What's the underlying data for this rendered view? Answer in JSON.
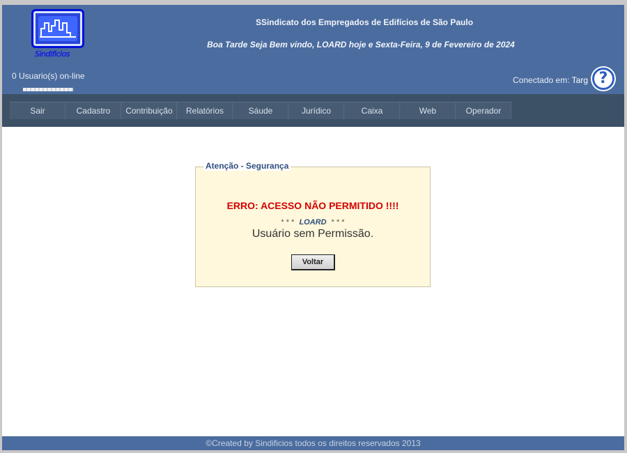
{
  "header": {
    "logo_text": "Sindificios",
    "users_online": "0 Usuario(s) on-line",
    "site_title": "SSindicato dos Empregados de Edifícios de São Paulo",
    "welcome": "Boa Tarde Seja Bem vindo, LOARD hoje e Sexta-Feira, 9 de Fevereiro de 2024",
    "connected_label": "Conectado em:",
    "connected_value": "Targ",
    "help_icon": "question-mark-icon",
    "help_symbol": "?"
  },
  "nav": {
    "items": [
      {
        "label": "Sair"
      },
      {
        "label": "Cadastro"
      },
      {
        "label": "Contribuição"
      },
      {
        "label": "Relatórios"
      },
      {
        "label": "Sáude"
      },
      {
        "label": "Jurídico"
      },
      {
        "label": "Caixa"
      },
      {
        "label": "Web"
      },
      {
        "label": "Operador"
      }
    ]
  },
  "alert": {
    "legend": "Atenção - Segurança",
    "error_title": "ERRO: ACESSO NÃO PERMITIDO !!!!",
    "stars_left": "* * *",
    "username": "LOARD",
    "stars_right": "* * *",
    "message": "Usuário sem Permissão.",
    "back_button": "Voltar"
  },
  "footer": {
    "text": "©Created by Sindificios todos os direitos reservados 2013"
  },
  "colors": {
    "header_bg": "#4b6c9e",
    "nav_bg": "#3d5166",
    "alert_bg": "#fff8dc",
    "error_red": "#d40000",
    "legend_blue": "#2f4f7f"
  }
}
